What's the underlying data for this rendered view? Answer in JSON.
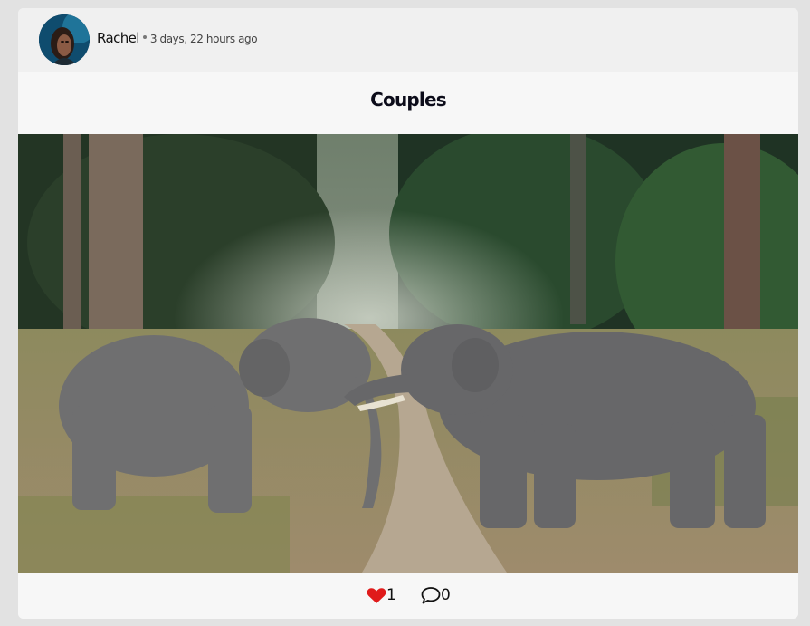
{
  "post": {
    "author": "Rachel",
    "time_ago": "3 days, 22 hours ago",
    "title": "Couples",
    "image_subject": "Two elephants touching trunks on a forest road",
    "likes": "1",
    "comments": "0"
  },
  "icons": {
    "avatar": "avatar-photo",
    "like": "heart-icon",
    "comment": "speech-bubble-icon"
  },
  "colors": {
    "like_heart": "#e01b1b",
    "card_background": "#f7f7f7",
    "page_background": "#e2e2e2"
  }
}
